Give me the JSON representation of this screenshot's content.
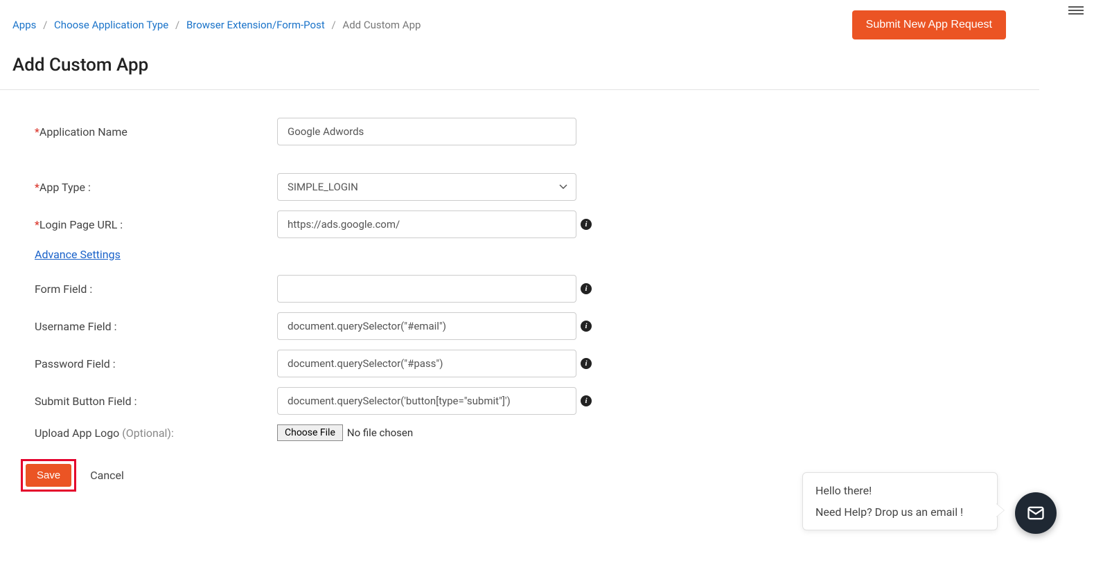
{
  "breadcrumb": {
    "items": [
      {
        "label": "Apps"
      },
      {
        "label": "Choose Application Type"
      },
      {
        "label": "Browser Extension/Form-Post"
      }
    ],
    "current": "Add Custom App"
  },
  "header": {
    "submit_btn": "Submit New App Request",
    "page_title": "Add Custom App"
  },
  "form": {
    "app_name_label": "Application Name",
    "app_name_value": "Google Adwords",
    "app_type_label": "App Type :",
    "app_type_value": "SIMPLE_LOGIN",
    "login_url_label": "Login Page URL :",
    "login_url_value": "https://ads.google.com/",
    "advance_settings": "Advance Settings",
    "form_field_label": "Form Field :",
    "form_field_value": "",
    "username_field_label": "Username Field :",
    "username_field_value": "document.querySelector(\"#email\")",
    "password_field_label": "Password Field :",
    "password_field_value": "document.querySelector(\"#pass\")",
    "submit_field_label": "Submit Button Field :",
    "submit_field_value": "document.querySelector('button[type=\"submit\"]')",
    "upload_label": "Upload App Logo ",
    "upload_optional": "(Optional):",
    "choose_file": "Choose File",
    "no_file": "No file chosen",
    "save": "Save",
    "cancel": "Cancel"
  },
  "chat": {
    "line1": "Hello there!",
    "line2": "Need Help? Drop us an email !"
  }
}
